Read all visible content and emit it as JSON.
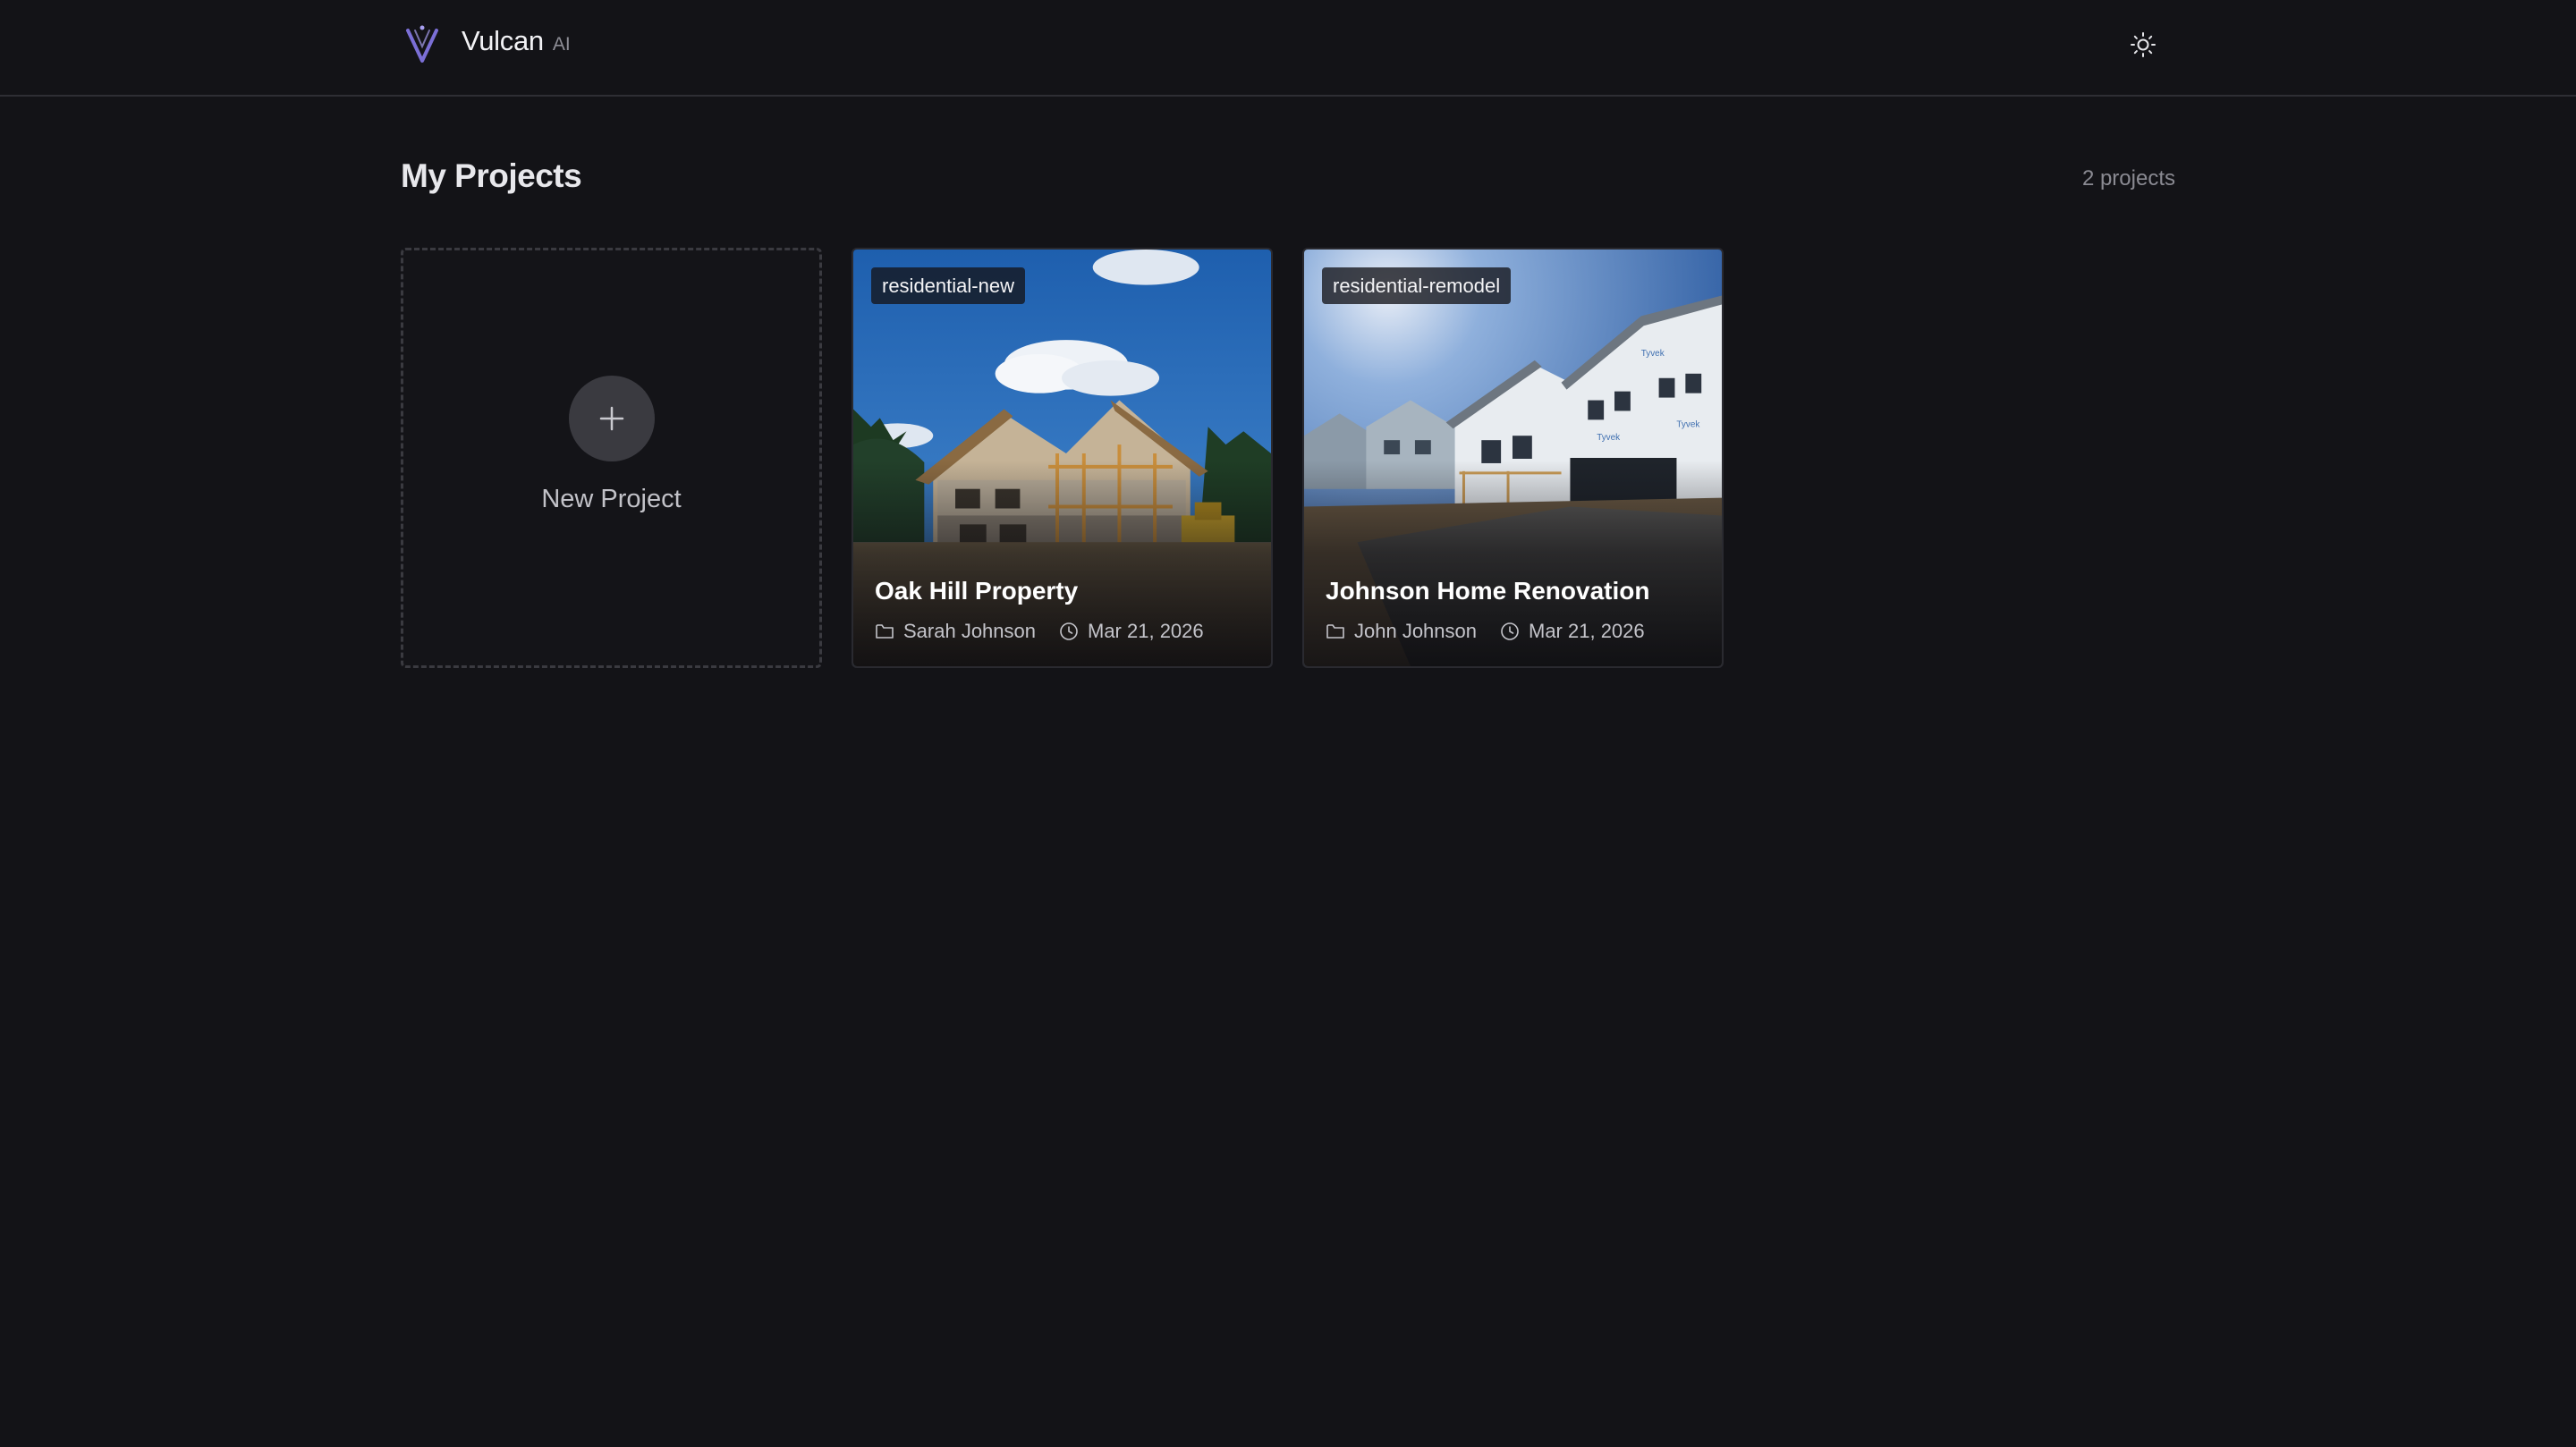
{
  "header": {
    "brand_name": "Vulcan",
    "brand_sub": "AI",
    "logo_icon": "vulcan-v-logo",
    "theme_icon": "sun-icon",
    "accent": "#7b6fd6"
  },
  "main": {
    "title": "My Projects",
    "count": "2 projects",
    "new_project_label": "New Project",
    "projects": [
      {
        "tag": "residential-new",
        "title": "Oak Hill Property",
        "owner": "Sarah Johnson",
        "date": "Mar 21, 2026"
      },
      {
        "tag": "residential-remodel",
        "title": "Johnson Home Renovation",
        "owner": "John Johnson",
        "date": "Mar 21, 2026"
      }
    ]
  }
}
